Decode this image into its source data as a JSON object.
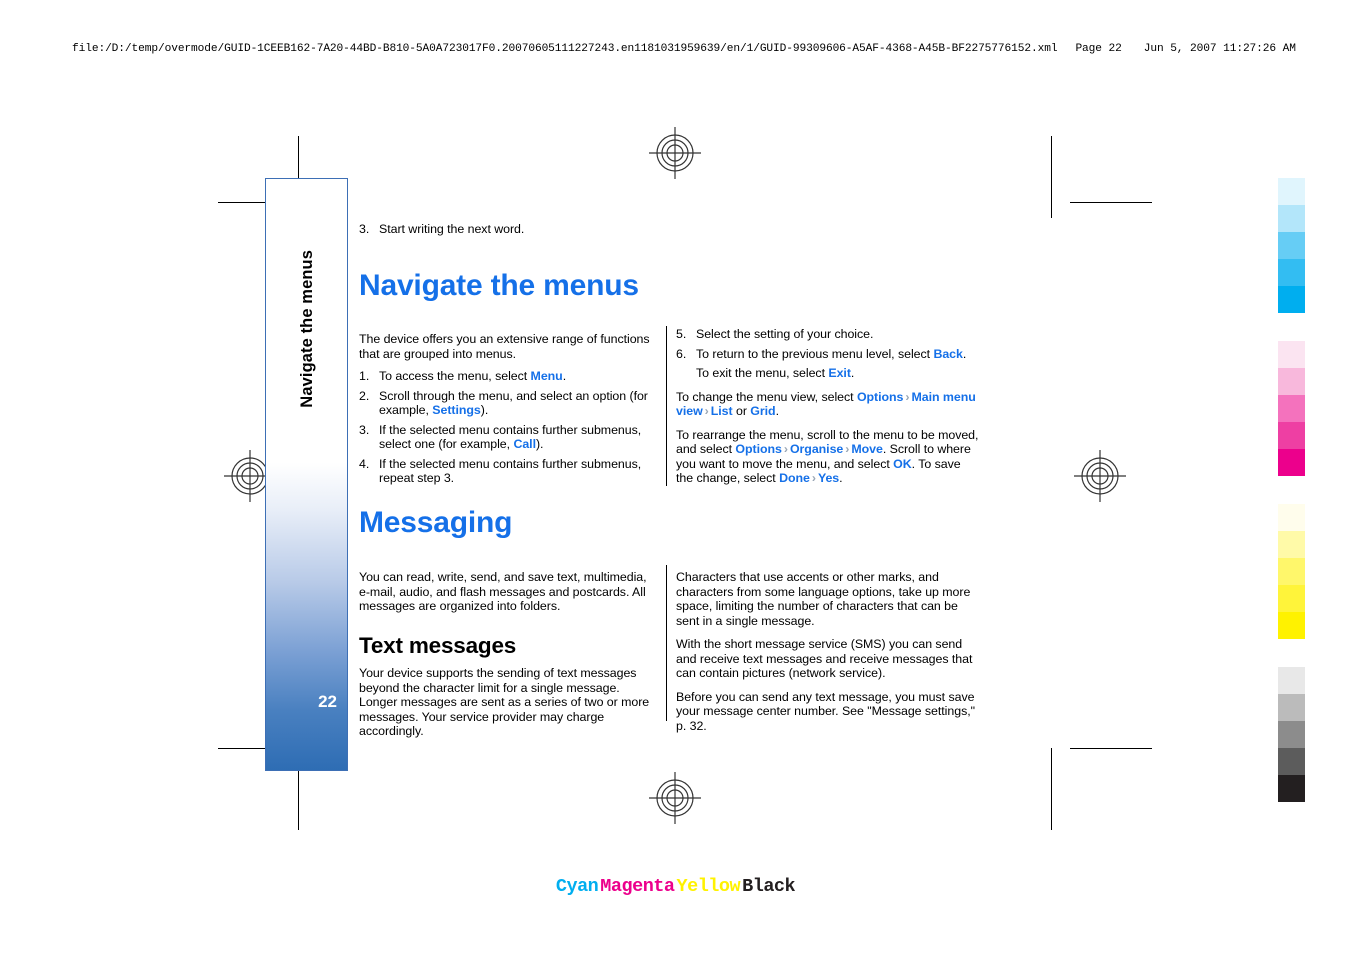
{
  "print_header": {
    "file_path": "file:/D:/temp/overmode/GUID-1CEEB162-7A20-44BD-B810-5A0A723017F0.20070605111227243.en1181031959639/en/1/GUID-99309606-A5AF-4368-A45B-BF2275776152.xml",
    "page_label": "Page 22",
    "timestamp": "Jun 5, 2007 11:27:26 AM"
  },
  "sidebar": {
    "tab_label": "Navigate the menus",
    "page_number": "22",
    "gradient_top": "#ffffff",
    "gradient_bottom": "#2e6db4",
    "border_color": "#3d6fb5"
  },
  "colors": {
    "heading_blue": "#1570e8",
    "keyword_blue": "#1570e8",
    "chevron_gray": "#9aa7b5",
    "text_black": "#000000"
  },
  "content": {
    "intro_step": {
      "num": "3.",
      "text": "Start writing the next word."
    },
    "sections": [
      {
        "title": "Navigate the menus",
        "left": {
          "lead": "The device offers you an extensive range of functions that are grouped into menus.",
          "steps": [
            {
              "num": "1.",
              "parts": [
                {
                  "t": "To access the menu, select "
                },
                {
                  "t": "Menu",
                  "kw": true
                },
                {
                  "t": "."
                }
              ]
            },
            {
              "num": "2.",
              "parts": [
                {
                  "t": "Scroll through the menu, and select an option (for example, "
                },
                {
                  "t": "Settings",
                  "kw": true
                },
                {
                  "t": ")."
                }
              ]
            },
            {
              "num": "3.",
              "parts": [
                {
                  "t": "If the selected menu contains further submenus, select one (for example, "
                },
                {
                  "t": "Call",
                  "kw": true
                },
                {
                  "t": ")."
                }
              ]
            },
            {
              "num": "4.",
              "parts": [
                {
                  "t": "If the selected menu contains further submenus, repeat step 3."
                }
              ]
            }
          ]
        },
        "right": {
          "steps": [
            {
              "num": "5.",
              "parts": [
                {
                  "t": "Select the setting of your choice."
                }
              ]
            },
            {
              "num": "6.",
              "parts": [
                {
                  "t": "To return to the previous menu level, select "
                },
                {
                  "t": "Back",
                  "kw": true
                },
                {
                  "t": "."
                }
              ]
            },
            {
              "num": "",
              "parts": [
                {
                  "t": "To exit the menu, select "
                },
                {
                  "t": "Exit",
                  "kw": true
                },
                {
                  "t": "."
                }
              ]
            }
          ],
          "paragraphs": [
            {
              "parts": [
                {
                  "t": "To change the menu view, select "
                },
                {
                  "t": "Options",
                  "kw": true
                },
                {
                  "chev": true
                },
                {
                  "t": "Main menu view",
                  "kw": true
                },
                {
                  "chev": true
                },
                {
                  "t": "List",
                  "kw": true
                },
                {
                  "t": " or "
                },
                {
                  "t": "Grid",
                  "kw": true
                },
                {
                  "t": "."
                }
              ]
            },
            {
              "parts": [
                {
                  "t": "To rearrange the menu, scroll to the menu to be moved, and select "
                },
                {
                  "t": "Options",
                  "kw": true
                },
                {
                  "chev": true
                },
                {
                  "t": "Organise",
                  "kw": true
                },
                {
                  "chev": true
                },
                {
                  "t": "Move",
                  "kw": true
                },
                {
                  "t": ". Scroll to where you want to move the menu, and select "
                },
                {
                  "t": "OK",
                  "kw": true
                },
                {
                  "t": ". To save the change, select "
                },
                {
                  "t": "Done",
                  "kw": true
                },
                {
                  "chev": true
                },
                {
                  "t": "Yes",
                  "kw": true
                },
                {
                  "t": "."
                }
              ]
            }
          ]
        }
      },
      {
        "title": "Messaging",
        "left": {
          "lead": "You can read, write, send, and save text, multimedia, e-mail, audio, and flash messages and postcards. All messages are organized into folders.",
          "subtitle": "Text messages",
          "sub_body": "Your device supports the sending of text messages beyond the character limit for a single message. Longer messages are sent as a series of two or more messages. Your service provider may charge accordingly."
        },
        "right": {
          "paragraphs": [
            "Characters that use accents or other marks, and characters from some language options, take up more space, limiting the number of characters that can be sent in a single message.",
            "With the short message service (SMS) you can send and receive text messages and receive messages that can contain pictures (network service).",
            "Before you can send any text message, you must save your message center number. See \"Message settings,\" p. 32."
          ]
        }
      }
    ]
  },
  "color_bars": {
    "names": [
      {
        "label": "Cyan",
        "color": "#00aeef"
      },
      {
        "label": "Magenta",
        "color": "#ec008c"
      },
      {
        "label": "Yellow",
        "color": "#fff200"
      },
      {
        "label": "Black",
        "color": "#231f20"
      }
    ],
    "ramps": [
      {
        "name": "cyan-ramp",
        "swatches": [
          "#e0f5fd",
          "#b3e6fa",
          "#66cdf5",
          "#33bdf2",
          "#00aeef"
        ]
      },
      {
        "name": "magenta-ramp",
        "swatches": [
          "#fbe4f1",
          "#f8b8dc",
          "#f472bd",
          "#ee3fa3",
          "#ec008c"
        ]
      },
      {
        "name": "yellow-ramp",
        "swatches": [
          "#fffdec",
          "#fffaa8",
          "#fff76b",
          "#fff43a",
          "#fff200"
        ]
      },
      {
        "name": "black-ramp",
        "swatches": [
          "#e8e8e8",
          "#bbbbbb",
          "#8c8c8c",
          "#5c5c5c",
          "#231f20"
        ]
      }
    ]
  }
}
